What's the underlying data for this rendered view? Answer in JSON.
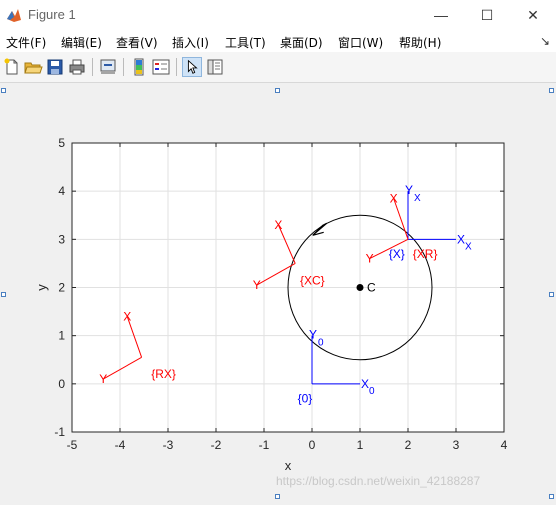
{
  "window": {
    "title": "Figure 1",
    "icon": "matlab-icon"
  },
  "menu": [
    "文件(F)",
    "编辑(E)",
    "查看(V)",
    "插入(I)",
    "工具(T)",
    "桌面(D)",
    "窗口(W)",
    "帮助(H)"
  ],
  "menu_right": "↘",
  "toolbar": [
    "new-figure-icon",
    "open-file-icon",
    "save-icon",
    "print-icon",
    "link-icon",
    "insert-colorbar-icon",
    "insert-legend-icon",
    "edit-plot-icon",
    "property-inspector-icon"
  ],
  "chart_data": {
    "type": "line",
    "xlabel": "x",
    "ylabel": "y",
    "xlim": [
      -5,
      4
    ],
    "ylim": [
      -1,
      5
    ],
    "xticks": [
      -5,
      -4,
      -3,
      -2,
      -1,
      0,
      1,
      2,
      3,
      4
    ],
    "yticks": [
      -1,
      0,
      1,
      2,
      3,
      4,
      5
    ],
    "grid": true,
    "colors": {
      "world": "#0000ff",
      "frames": "#ff0000",
      "circle": "#000000"
    },
    "circle": {
      "center": [
        1,
        2
      ],
      "radius": 1.5,
      "direction": "counter-clockwise"
    },
    "point_c": {
      "x": 1,
      "y": 2,
      "label": "C"
    },
    "frames": [
      {
        "label": "{0}",
        "origin": [
          0,
          0
        ],
        "x_end": [
          1,
          0
        ],
        "y_end": [
          0,
          1
        ],
        "x_label": "X",
        "x_sub": "0",
        "y_label": "Y",
        "y_sub": "0",
        "color": "#0000ff",
        "label_pos": [
          -0.3,
          -0.3
        ]
      },
      {
        "label": "{X}",
        "origin": [
          2,
          3
        ],
        "x_end": [
          3,
          3
        ],
        "y_end": [
          2,
          4
        ],
        "x_label": "X",
        "x_sub": "X",
        "y_label": "Y",
        "y_sub": "X",
        "color": "#0000ff",
        "label_pos": [
          1.6,
          2.7
        ]
      },
      {
        "label": "{XR}",
        "origin": [
          2,
          3
        ],
        "x_end": [
          1.7,
          3.85
        ],
        "y_end": [
          1.2,
          2.6
        ],
        "x_label": "X",
        "x_sub": "",
        "y_label": "Y",
        "y_sub": "",
        "color": "#ff0000",
        "label_pos": [
          2.1,
          2.7
        ]
      },
      {
        "label": "{XC}",
        "origin": [
          -0.35,
          2.5
        ],
        "x_end": [
          -0.7,
          3.3
        ],
        "y_end": [
          -1.15,
          2.05
        ],
        "x_label": "X",
        "x_sub": "",
        "y_label": "Y",
        "y_sub": "",
        "color": "#ff0000",
        "label_pos": [
          -0.25,
          2.15
        ]
      },
      {
        "label": "{RX}",
        "origin": [
          -3.55,
          0.55
        ],
        "x_end": [
          -3.85,
          1.4
        ],
        "y_end": [
          -4.35,
          0.1
        ],
        "x_label": "X",
        "x_sub": "",
        "y_label": "Y",
        "y_sub": "",
        "color": "#ff0000",
        "label_pos": [
          -3.35,
          0.2
        ]
      }
    ]
  },
  "watermark": "https://blog.csdn.net/weixin_42188287"
}
